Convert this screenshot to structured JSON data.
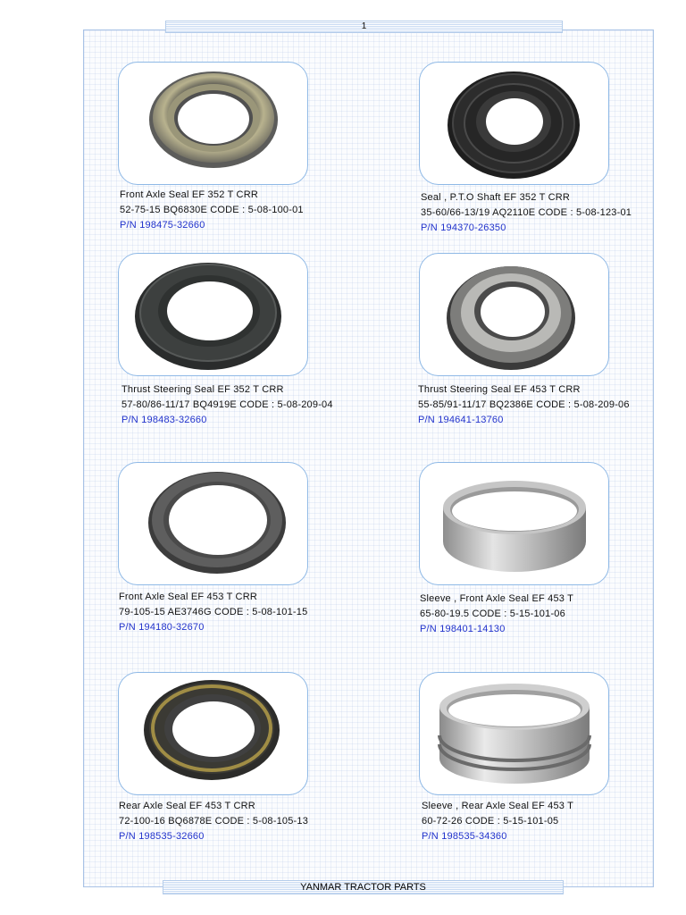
{
  "header": {
    "page_number": "1"
  },
  "footer": {
    "title": "YANMAR TRACTOR PARTS"
  },
  "parts": [
    {
      "name": "Front Axle Seal  EF 352 T CRR",
      "spec": "52-75-15 BQ6830E CODE : 5-08-100-01",
      "pn": "P/N 198475-32660",
      "image": "oil-seal-gold-icon"
    },
    {
      "name": "Seal , P.T.O  Shaft EF 352 T CRR",
      "spec": "35-60/66-13/19 AQ2110E   CODE : 5-08-123-01",
      "pn": "P/N 194370-26350",
      "image": "oil-seal-black-icon"
    },
    {
      "name": "Thrust Steering Seal   EF 352 T CRR",
      "spec": "57-80/86-11/17 BQ4919E CODE : 5-08-209-04",
      "pn": "P/N 198483-32660",
      "image": "oil-seal-black-icon"
    },
    {
      "name": "Thrust Steering Seal EF 453 T CRR",
      "spec": "55-85/91-11/17  BQ2386E CODE : 5-08-209-06",
      "pn": "P/N 194641-13760",
      "image": "oil-seal-grey-icon"
    },
    {
      "name": "Front Axle Seal EF 453 T CRR",
      "spec": "79-105-15  AE3746G CODE : 5-08-101-15",
      "pn": "P/N 194180-32670",
      "image": "oil-seal-dark-icon"
    },
    {
      "name": "Sleeve  , Front Axle Seal EF 453 T",
      "spec": "65-80-19.5  CODE : 5-15-101-06",
      "pn": "P/N 198401-14130",
      "image": "steel-sleeve-icon"
    },
    {
      "name": "Rear Axle Seal  EF 453 T CRR",
      "spec": "72-100-16  BQ6878E    CODE : 5-08-105-13",
      "pn": "P/N 198535-32660",
      "image": "oil-seal-gold-rim-icon"
    },
    {
      "name": "Sleeve  , Rear Axle Seal EF 453 T",
      "spec": "60-72-26 CODE : 5-15-101-05",
      "pn": "P/N 198535-34360",
      "image": "grooved-sleeve-icon"
    }
  ],
  "colors": {
    "frame": "#a9c3e6",
    "card_border": "#8fb9e6",
    "part_number": "#2233cc"
  }
}
